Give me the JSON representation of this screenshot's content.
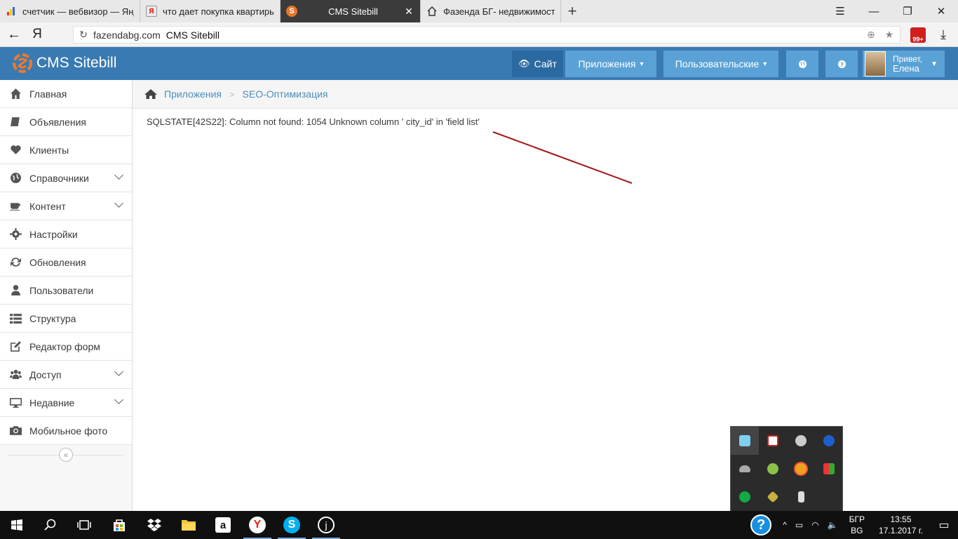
{
  "browser": {
    "tabs": [
      {
        "title": "счетчик — вебвизор — Янд",
        "active": false,
        "favicon": "bar-chart-icon"
      },
      {
        "title": "что дает покупка квартиры",
        "active": false,
        "favicon": "yandex-icon"
      },
      {
        "title": "CMS Sitebill",
        "active": true,
        "favicon": "sitebill-icon"
      },
      {
        "title": "Фазенда БГ- недвижимость",
        "active": false,
        "favicon": "house-icon"
      }
    ],
    "new_tab": "+",
    "address": {
      "domain": "fazendabg.com",
      "title": "CMS Sitebill"
    },
    "yandex_logo": "Я",
    "extension_badge": "99+"
  },
  "header": {
    "brand": "CMS Sitebill",
    "site_label": "Сайт",
    "apps_label": "Приложения",
    "users_label": "Пользовательские",
    "greeting": "Привет,",
    "user_name": "Елена",
    "accent_color": "#3a7ab2"
  },
  "sidebar": {
    "items": [
      {
        "label": "Главная",
        "icon": "home-icon",
        "has_submenu": false
      },
      {
        "label": "Объявления",
        "icon": "book-icon",
        "has_submenu": false
      },
      {
        "label": "Клиенты",
        "icon": "heart-icon",
        "has_submenu": false
      },
      {
        "label": "Справочники",
        "icon": "globe-icon",
        "has_submenu": true
      },
      {
        "label": "Контент",
        "icon": "coffee-icon",
        "has_submenu": true
      },
      {
        "label": "Настройки",
        "icon": "gear-icon",
        "has_submenu": false
      },
      {
        "label": "Обновления",
        "icon": "refresh-icon",
        "has_submenu": false
      },
      {
        "label": "Пользователи",
        "icon": "user-icon",
        "has_submenu": false
      },
      {
        "label": "Структура",
        "icon": "list-icon",
        "has_submenu": false
      },
      {
        "label": "Редактор форм",
        "icon": "edit-icon",
        "has_submenu": false
      },
      {
        "label": "Доступ",
        "icon": "group-icon",
        "has_submenu": true
      },
      {
        "label": "Недавние",
        "icon": "desktop-icon",
        "has_submenu": true
      },
      {
        "label": "Мобильное фото",
        "icon": "camera-icon",
        "has_submenu": false
      }
    ]
  },
  "breadcrumb": {
    "items": [
      "Приложения",
      "SEO-Оптимизация"
    ]
  },
  "main": {
    "error": "SQLSTATE[42S22]: Column not found: 1054 Unknown column ' city_id' in 'field list'"
  },
  "taskbar": {
    "lang_top": "БГР",
    "lang_bottom": "BG",
    "time": "13:55",
    "date": "17.1.2017 г."
  }
}
